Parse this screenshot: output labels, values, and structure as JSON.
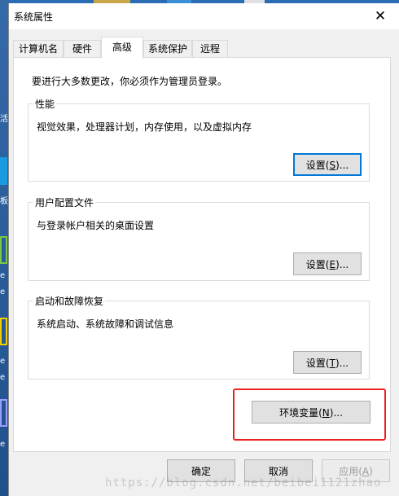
{
  "window": {
    "title": "系统属性"
  },
  "tabs": [
    "计算机名",
    "硬件",
    "高级",
    "系统保护",
    "远程"
  ],
  "active_tab": "高级",
  "admin_note": "要进行大多数更改，你必须作为管理员登录。",
  "performance": {
    "title": "性能",
    "desc": "视觉效果，处理器计划，内存使用，以及虚拟内存",
    "btn_pre": "设置(",
    "btn_key": "S",
    "btn_post": ")..."
  },
  "user_profiles": {
    "title": "用户配置文件",
    "desc": "与登录帐户相关的桌面设置",
    "btn_pre": "设置(",
    "btn_key": "E",
    "btn_post": ")..."
  },
  "startup": {
    "title": "启动和故障恢复",
    "desc": "系统启动、系统故障和调试信息",
    "btn_pre": "设置(",
    "btn_key": "T",
    "btn_post": ")..."
  },
  "env": {
    "btn_pre": "环境变量(",
    "btn_key": "N",
    "btn_post": ")..."
  },
  "footer": {
    "ok": "确定",
    "cancel": "取消",
    "apply_pre": "应用(",
    "apply_key": "A",
    "apply_post": ")"
  },
  "desktop_fragments": [
    "活",
    "板",
    "e",
    "e",
    "e",
    "e",
    "e"
  ],
  "watermark": "https://blog.csdn.net/beibei1121zhao",
  "colors": {
    "highlight": "#e8231f",
    "focus": "#0078d7",
    "desktop": "#2a6db5"
  }
}
